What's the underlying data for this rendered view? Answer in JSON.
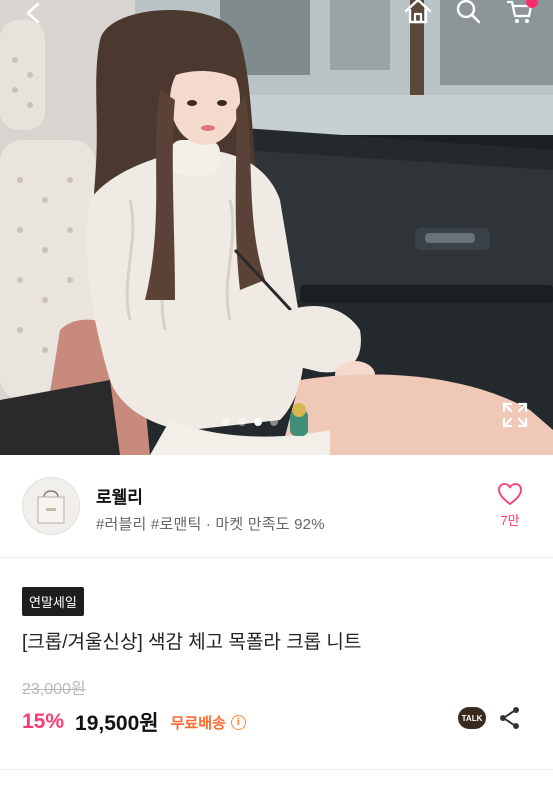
{
  "header": {
    "icons": [
      "back-icon",
      "home-icon",
      "search-icon",
      "cart-icon"
    ],
    "cart_badge_color": "#ff2c6a"
  },
  "gallery": {
    "image_description_hidden": true,
    "current_index": 2,
    "total": 4
  },
  "store": {
    "name": "로웰리",
    "tags": "#러블리 #로맨틱 · 마켓 만족도 92%",
    "like_count": "7만"
  },
  "product": {
    "badge": "연말세일",
    "title": "[크롭/겨울신상] 색감 체고 목폴라 크롭 니트",
    "original_price": "23,000원",
    "discount": "15%",
    "price": "19,500원",
    "shipping": "무료배송",
    "talk_label": "TALK"
  },
  "colors": {
    "accent_pink": "#ff3a74",
    "shipping_orange": "#ff6a2f",
    "badge_bg": "#1e1e1e"
  }
}
